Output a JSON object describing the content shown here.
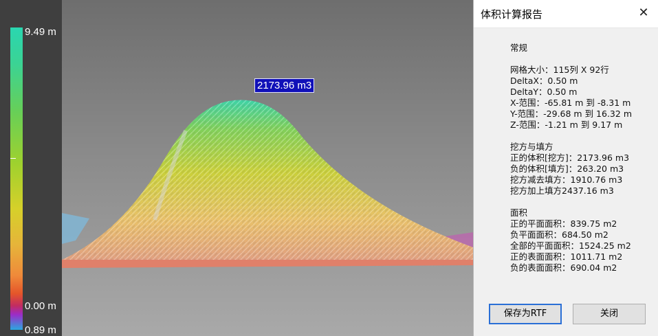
{
  "viewport": {
    "volume_label": "2173.96 m3",
    "scale": {
      "max_label": "9.49 m",
      "zero_label": "0.00 m",
      "min_label": "0.89 m"
    }
  },
  "dialog": {
    "title": "体积计算报告",
    "close_icon": "close-icon",
    "sections": [
      {
        "title": "常规",
        "lines": [
          "网格大小：115列 X 92行",
          "DeltaX：0.50 m",
          "DeltaY：0.50 m",
          "X-范围：-65.81 m 到 -8.31 m",
          "Y-范围：-29.68 m 到 16.32 m",
          "Z-范围：-1.21 m 到 9.17 m"
        ]
      },
      {
        "title": "挖方与填方",
        "lines": [
          "正的体积[挖方]：2173.96 m3",
          "负的体积[填方]：263.20 m3",
          "挖方减去填方：1910.76 m3",
          "挖方加上填方2437.16 m3"
        ]
      },
      {
        "title": "面积",
        "lines": [
          "正的平面面积：839.75 m2",
          "负平面面积：684.50 m2",
          "全部的平面面积：1524.25 m2",
          "正的表面面积：1011.71 m2",
          "负的表面面积：690.04 m2"
        ]
      }
    ],
    "buttons": {
      "save": "保存为RTF",
      "close": "关闭"
    }
  }
}
